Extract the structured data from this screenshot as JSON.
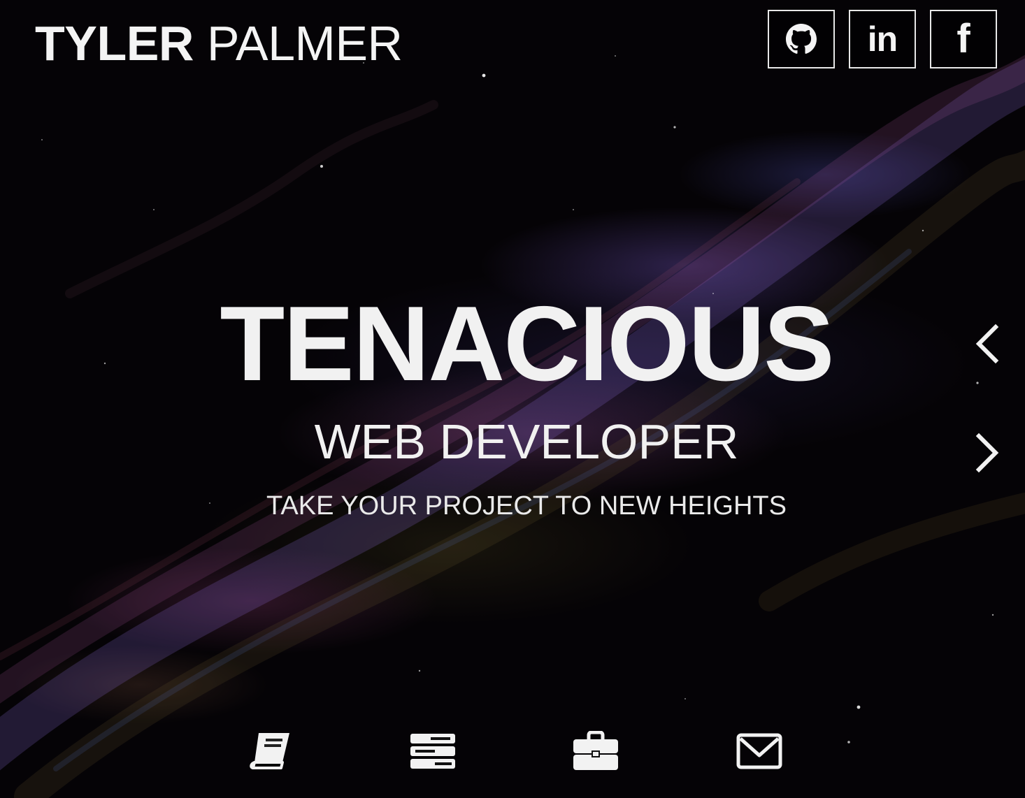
{
  "header": {
    "brand_first": "TYLER",
    "brand_last": "PALMER"
  },
  "social": [
    {
      "name": "github",
      "icon": "github-icon"
    },
    {
      "name": "linkedin",
      "icon": "linkedin-icon",
      "glyph": "in"
    },
    {
      "name": "facebook",
      "icon": "facebook-icon",
      "glyph": "f"
    }
  ],
  "hero": {
    "title": "TENACIOUS",
    "subtitle": "WEB DEVELOPER",
    "tagline": "TAKE YOUR PROJECT TO NEW HEIGHTS"
  },
  "carousel": {
    "prev_icon": "chevron-left-icon",
    "next_icon": "chevron-right-icon"
  },
  "bottom_nav": [
    {
      "icon": "book-icon"
    },
    {
      "icon": "server-stack-icon"
    },
    {
      "icon": "briefcase-icon"
    },
    {
      "icon": "envelope-icon"
    }
  ],
  "colors": {
    "text": "#f2f2f2",
    "background": "#050306",
    "border": "#e8e8e8"
  }
}
